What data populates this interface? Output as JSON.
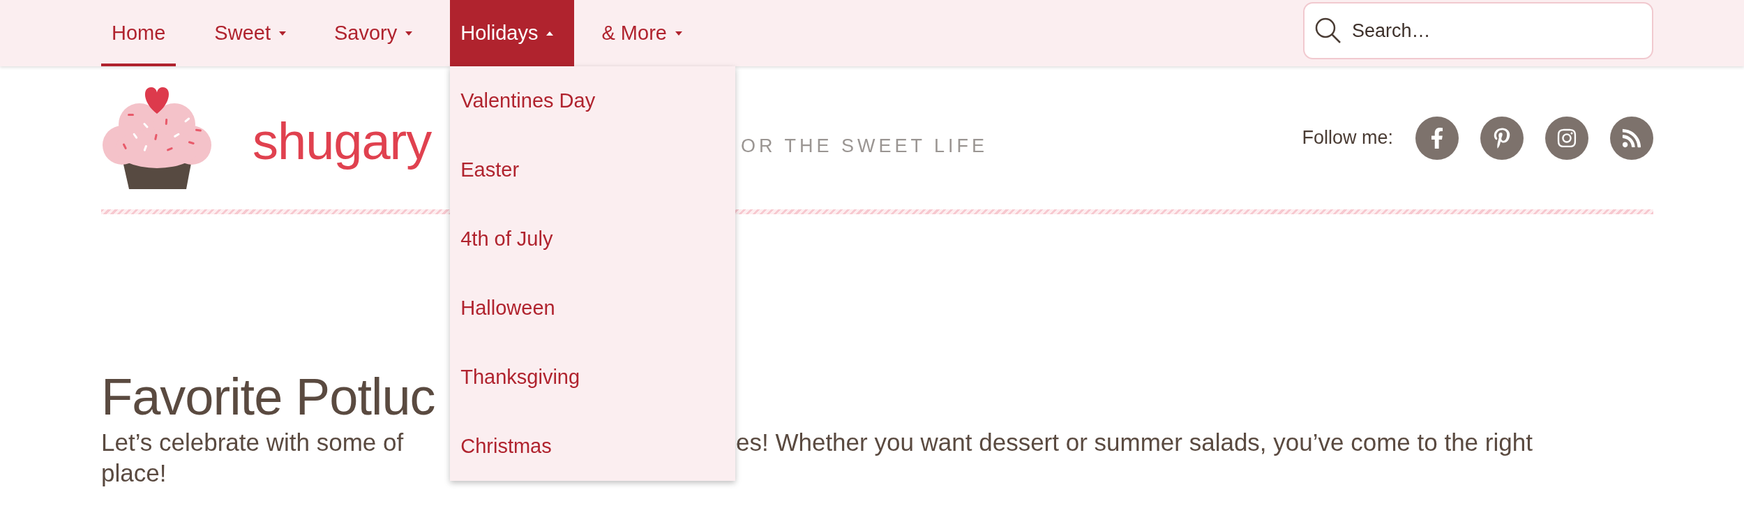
{
  "nav": {
    "items": [
      {
        "label": "Home",
        "selected": true,
        "has_menu": false,
        "expanded": false
      },
      {
        "label": "Sweet",
        "selected": false,
        "has_menu": true,
        "expanded": false
      },
      {
        "label": "Savory",
        "selected": false,
        "has_menu": true,
        "expanded": false
      },
      {
        "label": "Holidays",
        "selected": false,
        "has_menu": true,
        "expanded": true,
        "menu": [
          "Valentines Day",
          "Easter",
          "4th of July",
          "Halloween",
          "Thanksgiving",
          "Christmas"
        ]
      },
      {
        "label": "& More",
        "selected": false,
        "has_menu": true,
        "expanded": false
      }
    ],
    "search": {
      "placeholder": "Search…"
    }
  },
  "header": {
    "logo_text": "shugary",
    "tagline": "OR THE SWEET LIFE",
    "follow": {
      "label": "Follow me:",
      "links": [
        {
          "kind": "facebook"
        },
        {
          "kind": "pinterest"
        },
        {
          "kind": "instagram"
        },
        {
          "kind": "rss"
        }
      ]
    }
  },
  "intro": {
    "title": "Favorite Potluc",
    "text_parts": [
      "Let’s celebrate with some of",
      "es! Whether you want dessert or summer salads, you’ve come to the right",
      "place!"
    ]
  }
}
